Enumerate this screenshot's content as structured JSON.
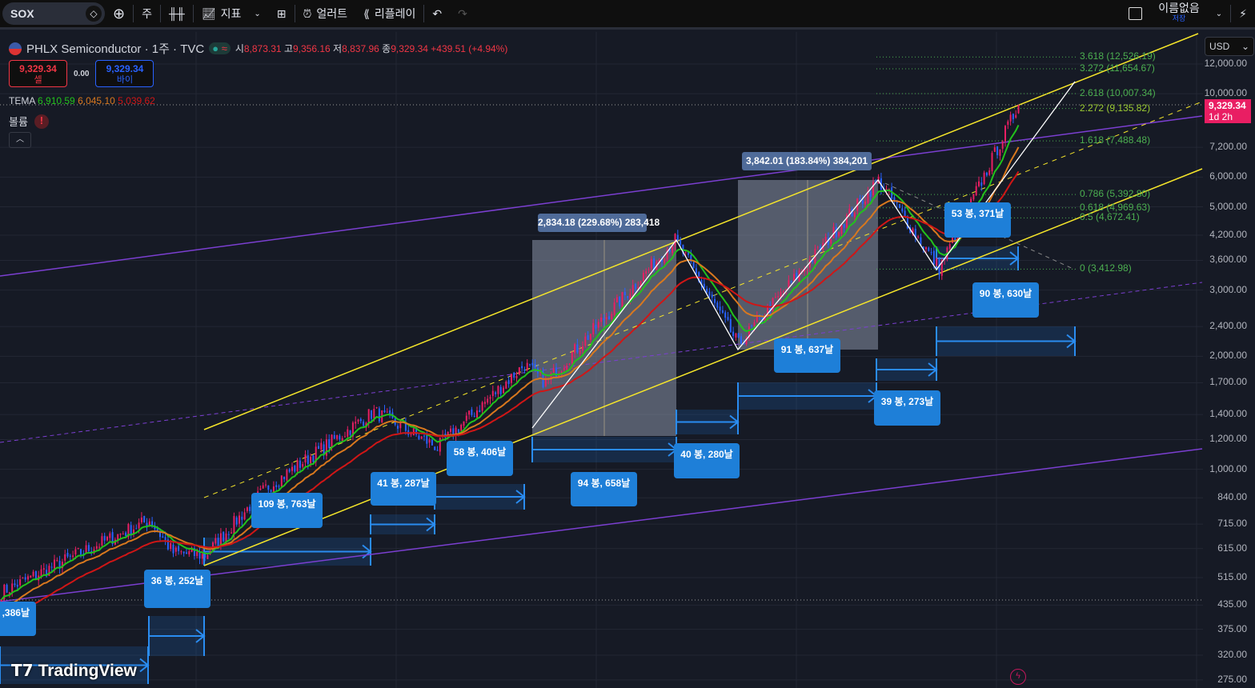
{
  "toolbar": {
    "symbol": "SOX",
    "interval": "주",
    "indicators": "지표",
    "alert": "얼러트",
    "replay": "리플레이",
    "layout_name": "이름없음",
    "layout_status": "저장"
  },
  "legend": {
    "name": "PHLX Semiconductor · 1주 · TVC",
    "open_label": "시",
    "open": "8,873.31",
    "high_label": "고",
    "high": "9,356.16",
    "low_label": "저",
    "low": "8,837.96",
    "close_label": "종",
    "close": "9,329.34",
    "change": "+439.51 (+4.94%)"
  },
  "trade": {
    "sell_price": "9,329.34",
    "sell_label": "셀",
    "spread": "0.00",
    "buy_price": "9,329.34",
    "buy_label": "바이"
  },
  "tema": {
    "label": "TEMA",
    "v1": "6,910.59",
    "v2": "6,045.10",
    "v3": "5,039.62"
  },
  "volume": {
    "label": "볼륨",
    "alert": "!"
  },
  "axis": {
    "currency": "USD",
    "price_tag": "9,329.34",
    "countdown": "1d 2h",
    "ticks": [
      "12,000.00",
      "10,000.00",
      "7,200.00",
      "6,000.00",
      "5,000.00",
      "4,200.00",
      "3,600.00",
      "3,000.00",
      "2,400.00",
      "2,000.00",
      "1,700.00",
      "1,400.00",
      "1,200.00",
      "1,000.00",
      "840.00",
      "715.00",
      "615.00",
      "515.00",
      "435.00",
      "375.00",
      "320.00",
      "275.00"
    ]
  },
  "fib": [
    "3.618 (12,526.19)",
    "3.272 (11,654.67)",
    "2.618 (10,007.34)",
    "2.272 (9,135.82)",
    "1.618 (7,488.48)",
    "0.786 (5,392.80)",
    "0.618 (4,969.63)",
    "0.5 (4,672.41)",
    "0 (3,412.98)"
  ],
  "ranges": {
    "r1": "2,834.18 (229.68%) 283,418",
    "r2": "3,842.01 (183.84%) 384,201"
  },
  "measures": [
    ",386날",
    "36 봉, 252날",
    "109 봉, 763날",
    "41 봉, 287날",
    "58 봉, 406날",
    "94 봉, 658날",
    "40 봉, 280날",
    "91 봉, 637날",
    "39 봉, 273날",
    "90 봉, 630날",
    "53 봉, 371날"
  ],
  "brand": "TradingView",
  "colors": {
    "up": "#e91e63",
    "down": "#2962ff",
    "tema_fast": "#22c21c",
    "tema_mid": "#d9781e",
    "tema_slow": "#d01616",
    "channel": "#f5e52a",
    "trend": "#7b3fd1"
  },
  "chart_data": {
    "type": "candlestick",
    "scale": "log",
    "ylim": [
      275,
      12000
    ],
    "waypoints": [
      [
        0,
        471
      ],
      [
        30,
        600
      ],
      [
        56,
        733
      ],
      [
        65,
        600
      ],
      [
        77,
        590
      ],
      [
        100,
        890
      ],
      [
        141,
        1425
      ],
      [
        165,
        1145
      ],
      [
        198,
        1900
      ],
      [
        206,
        1700
      ],
      [
        255,
        4080
      ],
      [
        279,
        2150
      ],
      [
        332,
        5880
      ],
      [
        355,
        3430
      ],
      [
        385,
        9329
      ]
    ],
    "last": {
      "open": 8873.31,
      "high": 9356.16,
      "low": 8837.96,
      "close": 9329.34
    }
  }
}
